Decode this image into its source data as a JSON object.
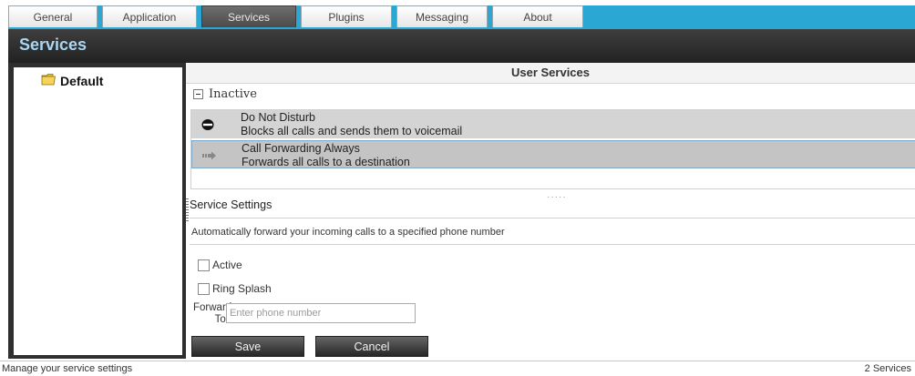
{
  "tabs": [
    {
      "label": "General"
    },
    {
      "label": "Application"
    },
    {
      "label": "Services"
    },
    {
      "label": "Plugins"
    },
    {
      "label": "Messaging"
    },
    {
      "label": "About"
    }
  ],
  "page_title": "Services",
  "tree": {
    "folder_label": "Default"
  },
  "user_services": {
    "header": "User Services",
    "group_label": "Inactive",
    "items": [
      {
        "name": "Do Not Disturb",
        "description": "Blocks all calls and sends them to voicemail",
        "icon": "do-not-disturb-icon"
      },
      {
        "name": "Call Forwarding Always",
        "description": "Forwards all calls to a destination",
        "icon": "forward-arrow-icon"
      }
    ]
  },
  "settings": {
    "label": "Service Settings",
    "description": "Automatically forward your incoming calls to a specified phone number",
    "active_label": "Active",
    "ring_splash_label": "Ring Splash",
    "forward_label_1": "Forward",
    "forward_label_2": "To :",
    "forward_value": "",
    "forward_placeholder": "Enter phone number",
    "save_label": "Save",
    "cancel_label": "Cancel"
  },
  "status": {
    "left": "Manage your service settings",
    "right": "2 Services"
  },
  "colors": {
    "tab_strip": "#2aa7d3",
    "title_text": "#a9d7f3",
    "selected_row_border": "#7fa9c8"
  }
}
